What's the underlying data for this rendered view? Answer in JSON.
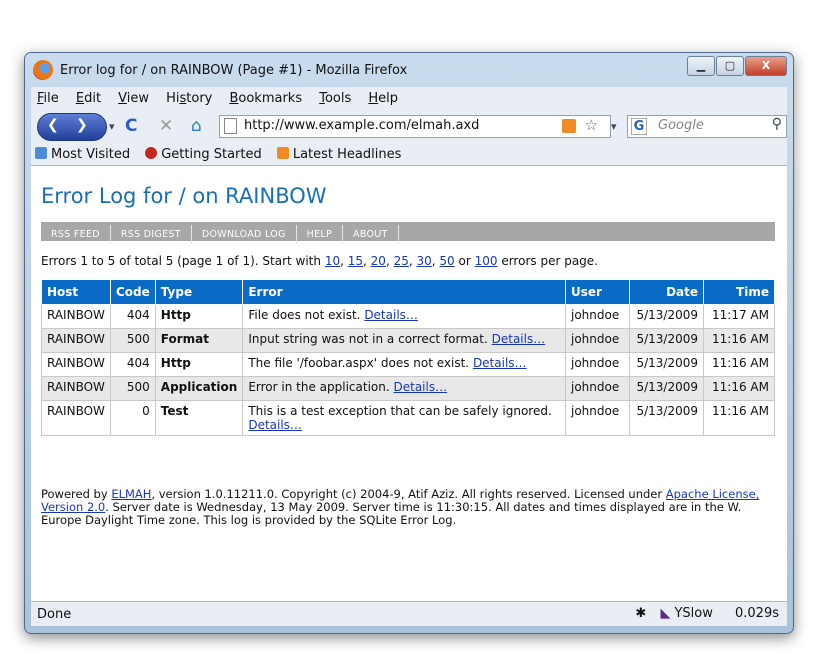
{
  "window": {
    "title": "Error log for / on RAINBOW (Page #1) - Mozilla Firefox",
    "minimize": "▁",
    "maximize": "▢",
    "close": "X"
  },
  "menu": [
    "File",
    "Edit",
    "View",
    "History",
    "Bookmarks",
    "Tools",
    "Help"
  ],
  "menu_underline": [
    "F",
    "E",
    "V",
    "s",
    "B",
    "T",
    "H"
  ],
  "nav": {
    "url": "http://www.example.com/elmah.axd",
    "search_placeholder": "Google"
  },
  "bookmarks": [
    "Most Visited",
    "Getting Started",
    "Latest Headlines"
  ],
  "page": {
    "title": "Error Log for / on RAINBOW",
    "speedbar": [
      "RSS FEED",
      "RSS DIGEST",
      "DOWNLOAD LOG",
      "HELP",
      "ABOUT"
    ],
    "summary_prefix": "Errors 1 to 5 of total 5 (page 1 of 1). Start with ",
    "page_sizes": [
      "10",
      "15",
      "20",
      "25",
      "30",
      "50",
      "100"
    ],
    "summary_suffix": " errors per page.",
    "columns": [
      "Host",
      "Code",
      "Type",
      "Error",
      "User",
      "Date",
      "Time"
    ],
    "rows": [
      {
        "host": "RAINBOW",
        "code": "404",
        "type": "Http",
        "error": "File does not exist.",
        "details": "Details…",
        "user": "johndoe",
        "date": "5/13/2009",
        "time": "11:17 AM"
      },
      {
        "host": "RAINBOW",
        "code": "500",
        "type": "Format",
        "error": "Input string was not in a correct format.",
        "details": "Details…",
        "user": "johndoe",
        "date": "5/13/2009",
        "time": "11:16 AM"
      },
      {
        "host": "RAINBOW",
        "code": "404",
        "type": "Http",
        "error": "The file '/foobar.aspx' does not exist.",
        "details": "Details…",
        "user": "johndoe",
        "date": "5/13/2009",
        "time": "11:16 AM"
      },
      {
        "host": "RAINBOW",
        "code": "500",
        "type": "Application",
        "error": "Error in the application.",
        "details": "Details…",
        "user": "johndoe",
        "date": "5/13/2009",
        "time": "11:16 AM"
      },
      {
        "host": "RAINBOW",
        "code": "0",
        "type": "Test",
        "error": "This is a test exception that can be safely ignored.",
        "details": "Details…",
        "user": "johndoe",
        "date": "5/13/2009",
        "time": "11:16 AM"
      }
    ],
    "footer": {
      "part1": "Powered by ",
      "elmah_link": "ELMAH",
      "part2": ", version 1.0.11211.0. Copyright (c) 2004-9, Atif Aziz. All rights reserved. Licensed under ",
      "license_link": "Apache License, Version 2.0",
      "part3": ". Server date is Wednesday, 13 May 2009. Server time is 11:30:15. All dates and times displayed are in the W. Europe Daylight Time zone. This log is provided by the SQLite Error Log."
    }
  },
  "status": {
    "text": "Done",
    "yslow": "YSlow",
    "load_time": "0.029s"
  }
}
